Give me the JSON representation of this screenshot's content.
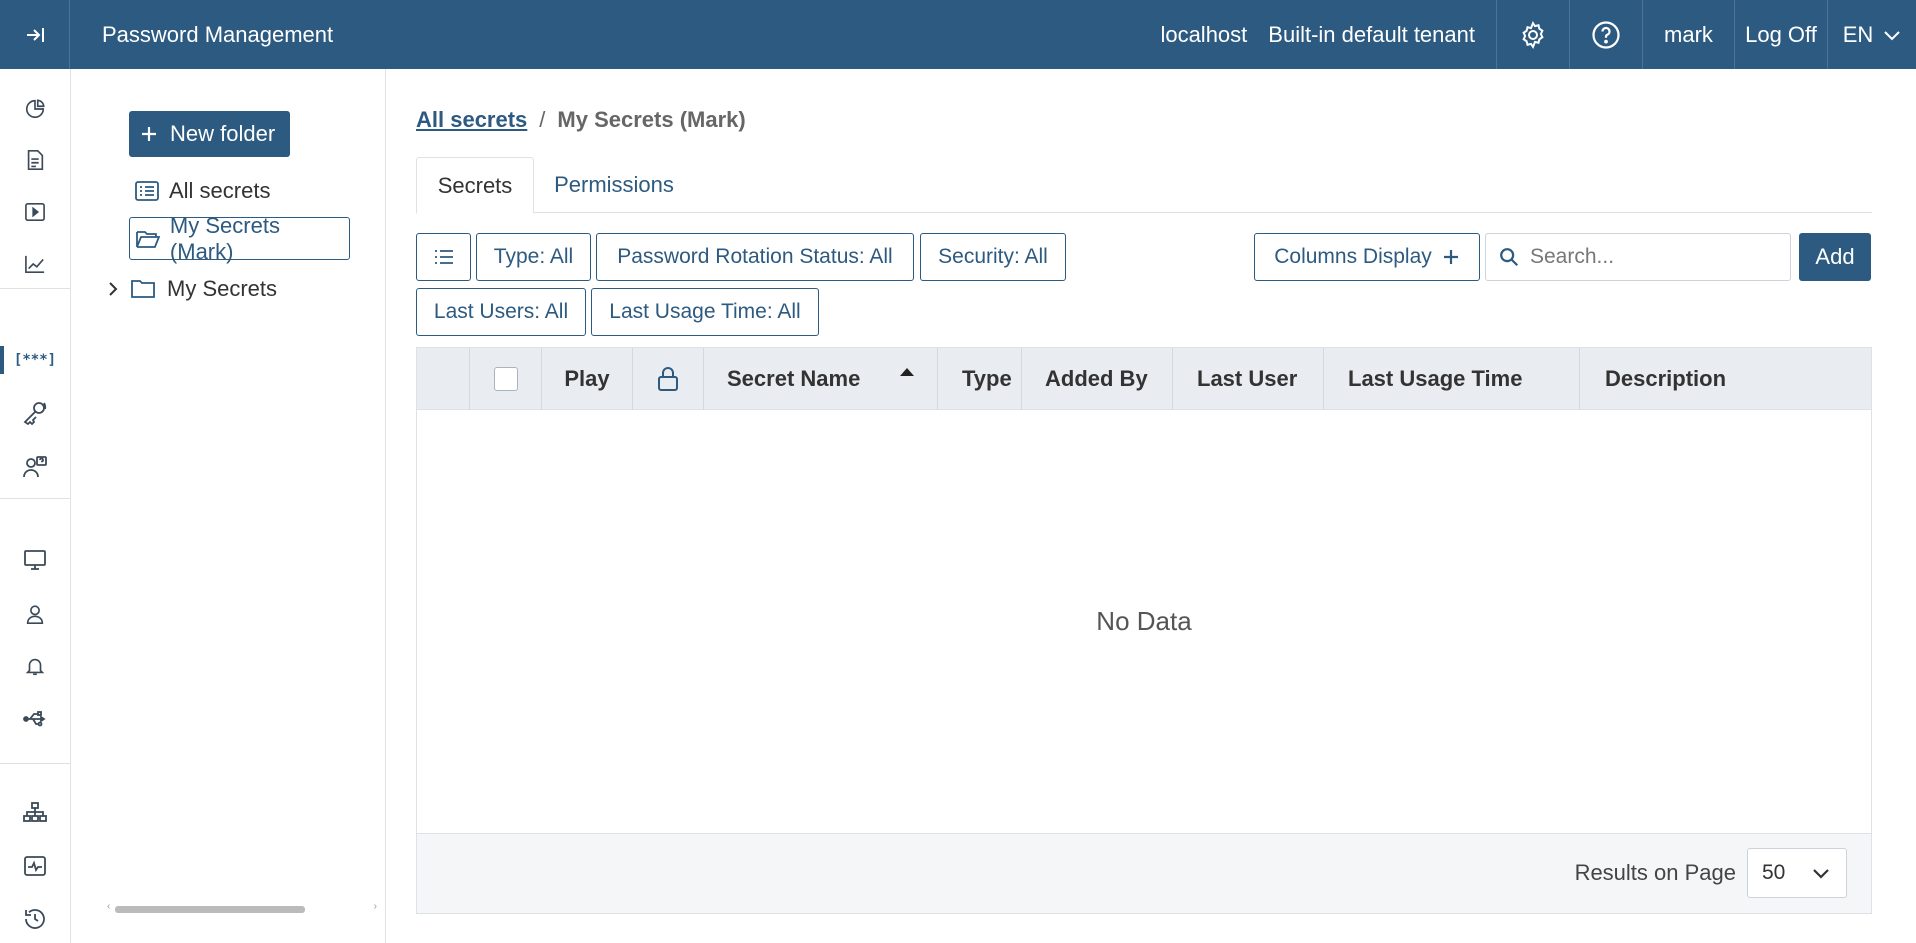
{
  "header": {
    "app_title": "Password Management",
    "host": "localhost",
    "tenant": "Built-in default tenant",
    "user": "mark",
    "logoff": "Log Off",
    "language": "EN"
  },
  "folders": {
    "new_folder_label": "New folder",
    "items": [
      {
        "label": "All secrets",
        "icon": "list-icon"
      },
      {
        "label": "My Secrets (Mark)",
        "icon": "folder-open-icon",
        "selected": true
      },
      {
        "label": "My Secrets",
        "icon": "folder-icon",
        "expandable": true
      }
    ]
  },
  "breadcrumb": {
    "root": "All secrets",
    "separator": "/",
    "current": "My Secrets (Mark)"
  },
  "tabs": [
    {
      "label": "Secrets",
      "active": true
    },
    {
      "label": "Permissions",
      "active": false
    }
  ],
  "filters": {
    "type": "Type: All",
    "rotation": "Password Rotation Status: All",
    "security": "Security: All",
    "last_users": "Last Users: All",
    "last_usage": "Last Usage Time: All",
    "columns_display": "Columns Display"
  },
  "search": {
    "placeholder": "Search...",
    "value": ""
  },
  "add_label": "Add",
  "table": {
    "columns": [
      "Play",
      "Secret Name",
      "Type",
      "Added By",
      "Last User",
      "Last Usage Time",
      "Description"
    ],
    "empty_text": "No Data",
    "sort_column": "Secret Name",
    "sort_direction": "ascending"
  },
  "pagination": {
    "label": "Results on Page",
    "page_size": "50"
  },
  "colors": {
    "primary": "#2d5a80",
    "header_bg": "#e9edf1",
    "border": "#dde2e7"
  }
}
